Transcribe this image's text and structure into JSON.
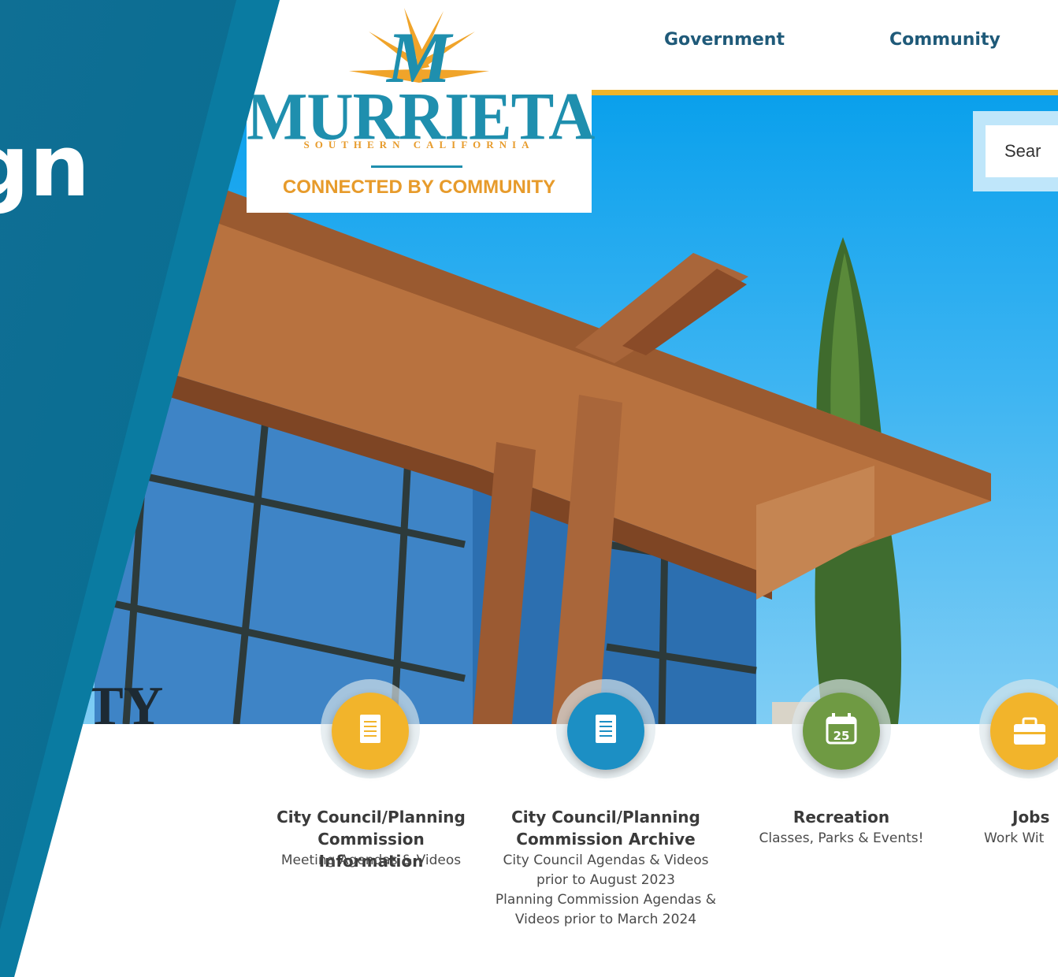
{
  "nav": {
    "government": "Government",
    "community": "Community"
  },
  "logo": {
    "name": "MURRIETA",
    "subtitle": "SOUTHERN CALIFORNIA",
    "tagline": "CONNECTED BY COMMUNITY"
  },
  "search": {
    "placeholder": "Sear"
  },
  "overlay": {
    "text": "gn"
  },
  "quick_links": [
    {
      "title_line1": "City Council/Planning",
      "title_line2": "Commission Information",
      "desc": [
        "Meeting Agendas & Videos"
      ],
      "color": "#f2b42b",
      "icon": "document-icon"
    },
    {
      "title_line1": "City Council/Planning",
      "title_line2": "Commission Archive",
      "desc": [
        "City Council Agendas & Videos",
        "prior to August 2023",
        "Planning Commission Agendas &",
        "Videos prior to March 2024"
      ],
      "color": "#1c8fc4",
      "icon": "document-icon"
    },
    {
      "title_line1": "Recreation",
      "title_line2": "",
      "desc": [
        "Classes, Parks & Events!"
      ],
      "color": "#6f9a43",
      "icon": "calendar-icon",
      "calendar_day": "25"
    },
    {
      "title_line1": "Jobs",
      "title_line2": "",
      "desc": [
        "Work Wit"
      ],
      "color": "#f2b42b",
      "icon": "briefcase-icon"
    }
  ],
  "colors": {
    "nav_text": "#1f5a79",
    "accent_gold": "#f0b429",
    "logo_teal": "#1f8fae",
    "logo_orange": "#e79b2b",
    "overlay_blue": "#0c6f95"
  }
}
